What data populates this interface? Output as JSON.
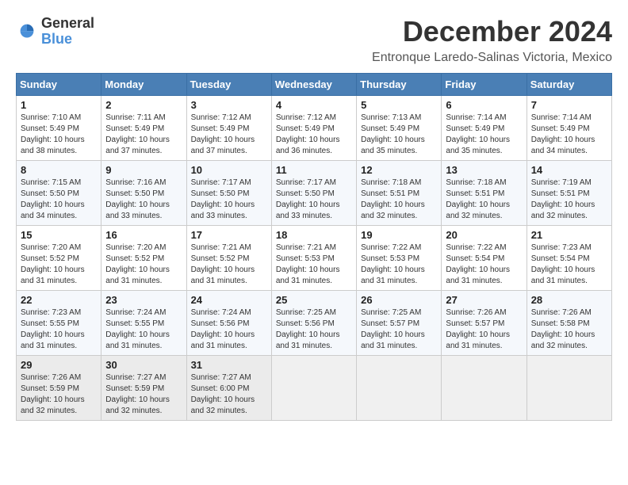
{
  "logo": {
    "general": "General",
    "blue": "Blue"
  },
  "title": {
    "month": "December 2024",
    "location": "Entronque Laredo-Salinas Victoria, Mexico"
  },
  "headers": [
    "Sunday",
    "Monday",
    "Tuesday",
    "Wednesday",
    "Thursday",
    "Friday",
    "Saturday"
  ],
  "weeks": [
    [
      {
        "day": "1",
        "sunrise": "7:10 AM",
        "sunset": "5:49 PM",
        "daylight": "10 hours and 38 minutes."
      },
      {
        "day": "2",
        "sunrise": "7:11 AM",
        "sunset": "5:49 PM",
        "daylight": "10 hours and 37 minutes."
      },
      {
        "day": "3",
        "sunrise": "7:12 AM",
        "sunset": "5:49 PM",
        "daylight": "10 hours and 37 minutes."
      },
      {
        "day": "4",
        "sunrise": "7:12 AM",
        "sunset": "5:49 PM",
        "daylight": "10 hours and 36 minutes."
      },
      {
        "day": "5",
        "sunrise": "7:13 AM",
        "sunset": "5:49 PM",
        "daylight": "10 hours and 35 minutes."
      },
      {
        "day": "6",
        "sunrise": "7:14 AM",
        "sunset": "5:49 PM",
        "daylight": "10 hours and 35 minutes."
      },
      {
        "day": "7",
        "sunrise": "7:14 AM",
        "sunset": "5:49 PM",
        "daylight": "10 hours and 34 minutes."
      }
    ],
    [
      {
        "day": "8",
        "sunrise": "7:15 AM",
        "sunset": "5:50 PM",
        "daylight": "10 hours and 34 minutes."
      },
      {
        "day": "9",
        "sunrise": "7:16 AM",
        "sunset": "5:50 PM",
        "daylight": "10 hours and 33 minutes."
      },
      {
        "day": "10",
        "sunrise": "7:17 AM",
        "sunset": "5:50 PM",
        "daylight": "10 hours and 33 minutes."
      },
      {
        "day": "11",
        "sunrise": "7:17 AM",
        "sunset": "5:50 PM",
        "daylight": "10 hours and 33 minutes."
      },
      {
        "day": "12",
        "sunrise": "7:18 AM",
        "sunset": "5:51 PM",
        "daylight": "10 hours and 32 minutes."
      },
      {
        "day": "13",
        "sunrise": "7:18 AM",
        "sunset": "5:51 PM",
        "daylight": "10 hours and 32 minutes."
      },
      {
        "day": "14",
        "sunrise": "7:19 AM",
        "sunset": "5:51 PM",
        "daylight": "10 hours and 32 minutes."
      }
    ],
    [
      {
        "day": "15",
        "sunrise": "7:20 AM",
        "sunset": "5:52 PM",
        "daylight": "10 hours and 31 minutes."
      },
      {
        "day": "16",
        "sunrise": "7:20 AM",
        "sunset": "5:52 PM",
        "daylight": "10 hours and 31 minutes."
      },
      {
        "day": "17",
        "sunrise": "7:21 AM",
        "sunset": "5:52 PM",
        "daylight": "10 hours and 31 minutes."
      },
      {
        "day": "18",
        "sunrise": "7:21 AM",
        "sunset": "5:53 PM",
        "daylight": "10 hours and 31 minutes."
      },
      {
        "day": "19",
        "sunrise": "7:22 AM",
        "sunset": "5:53 PM",
        "daylight": "10 hours and 31 minutes."
      },
      {
        "day": "20",
        "sunrise": "7:22 AM",
        "sunset": "5:54 PM",
        "daylight": "10 hours and 31 minutes."
      },
      {
        "day": "21",
        "sunrise": "7:23 AM",
        "sunset": "5:54 PM",
        "daylight": "10 hours and 31 minutes."
      }
    ],
    [
      {
        "day": "22",
        "sunrise": "7:23 AM",
        "sunset": "5:55 PM",
        "daylight": "10 hours and 31 minutes."
      },
      {
        "day": "23",
        "sunrise": "7:24 AM",
        "sunset": "5:55 PM",
        "daylight": "10 hours and 31 minutes."
      },
      {
        "day": "24",
        "sunrise": "7:24 AM",
        "sunset": "5:56 PM",
        "daylight": "10 hours and 31 minutes."
      },
      {
        "day": "25",
        "sunrise": "7:25 AM",
        "sunset": "5:56 PM",
        "daylight": "10 hours and 31 minutes."
      },
      {
        "day": "26",
        "sunrise": "7:25 AM",
        "sunset": "5:57 PM",
        "daylight": "10 hours and 31 minutes."
      },
      {
        "day": "27",
        "sunrise": "7:26 AM",
        "sunset": "5:57 PM",
        "daylight": "10 hours and 31 minutes."
      },
      {
        "day": "28",
        "sunrise": "7:26 AM",
        "sunset": "5:58 PM",
        "daylight": "10 hours and 32 minutes."
      }
    ],
    [
      {
        "day": "29",
        "sunrise": "7:26 AM",
        "sunset": "5:59 PM",
        "daylight": "10 hours and 32 minutes."
      },
      {
        "day": "30",
        "sunrise": "7:27 AM",
        "sunset": "5:59 PM",
        "daylight": "10 hours and 32 minutes."
      },
      {
        "day": "31",
        "sunrise": "7:27 AM",
        "sunset": "6:00 PM",
        "daylight": "10 hours and 32 minutes."
      },
      null,
      null,
      null,
      null
    ]
  ]
}
